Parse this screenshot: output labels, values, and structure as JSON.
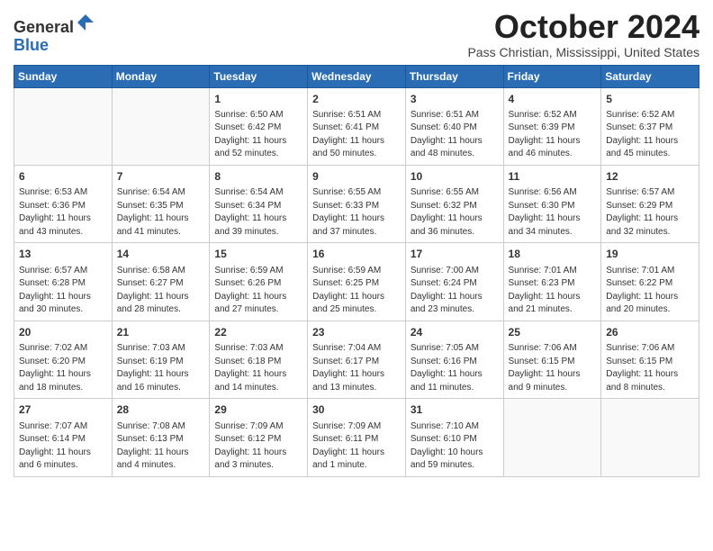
{
  "header": {
    "logo_general": "General",
    "logo_blue": "Blue",
    "month_title": "October 2024",
    "location": "Pass Christian, Mississippi, United States"
  },
  "days_of_week": [
    "Sunday",
    "Monday",
    "Tuesday",
    "Wednesday",
    "Thursday",
    "Friday",
    "Saturday"
  ],
  "weeks": [
    [
      {
        "day": "",
        "sunrise": "",
        "sunset": "",
        "daylight": "",
        "empty": true
      },
      {
        "day": "",
        "sunrise": "",
        "sunset": "",
        "daylight": "",
        "empty": true
      },
      {
        "day": "1",
        "sunrise": "Sunrise: 6:50 AM",
        "sunset": "Sunset: 6:42 PM",
        "daylight": "Daylight: 11 hours and 52 minutes.",
        "empty": false
      },
      {
        "day": "2",
        "sunrise": "Sunrise: 6:51 AM",
        "sunset": "Sunset: 6:41 PM",
        "daylight": "Daylight: 11 hours and 50 minutes.",
        "empty": false
      },
      {
        "day": "3",
        "sunrise": "Sunrise: 6:51 AM",
        "sunset": "Sunset: 6:40 PM",
        "daylight": "Daylight: 11 hours and 48 minutes.",
        "empty": false
      },
      {
        "day": "4",
        "sunrise": "Sunrise: 6:52 AM",
        "sunset": "Sunset: 6:39 PM",
        "daylight": "Daylight: 11 hours and 46 minutes.",
        "empty": false
      },
      {
        "day": "5",
        "sunrise": "Sunrise: 6:52 AM",
        "sunset": "Sunset: 6:37 PM",
        "daylight": "Daylight: 11 hours and 45 minutes.",
        "empty": false
      }
    ],
    [
      {
        "day": "6",
        "sunrise": "Sunrise: 6:53 AM",
        "sunset": "Sunset: 6:36 PM",
        "daylight": "Daylight: 11 hours and 43 minutes.",
        "empty": false
      },
      {
        "day": "7",
        "sunrise": "Sunrise: 6:54 AM",
        "sunset": "Sunset: 6:35 PM",
        "daylight": "Daylight: 11 hours and 41 minutes.",
        "empty": false
      },
      {
        "day": "8",
        "sunrise": "Sunrise: 6:54 AM",
        "sunset": "Sunset: 6:34 PM",
        "daylight": "Daylight: 11 hours and 39 minutes.",
        "empty": false
      },
      {
        "day": "9",
        "sunrise": "Sunrise: 6:55 AM",
        "sunset": "Sunset: 6:33 PM",
        "daylight": "Daylight: 11 hours and 37 minutes.",
        "empty": false
      },
      {
        "day": "10",
        "sunrise": "Sunrise: 6:55 AM",
        "sunset": "Sunset: 6:32 PM",
        "daylight": "Daylight: 11 hours and 36 minutes.",
        "empty": false
      },
      {
        "day": "11",
        "sunrise": "Sunrise: 6:56 AM",
        "sunset": "Sunset: 6:30 PM",
        "daylight": "Daylight: 11 hours and 34 minutes.",
        "empty": false
      },
      {
        "day": "12",
        "sunrise": "Sunrise: 6:57 AM",
        "sunset": "Sunset: 6:29 PM",
        "daylight": "Daylight: 11 hours and 32 minutes.",
        "empty": false
      }
    ],
    [
      {
        "day": "13",
        "sunrise": "Sunrise: 6:57 AM",
        "sunset": "Sunset: 6:28 PM",
        "daylight": "Daylight: 11 hours and 30 minutes.",
        "empty": false
      },
      {
        "day": "14",
        "sunrise": "Sunrise: 6:58 AM",
        "sunset": "Sunset: 6:27 PM",
        "daylight": "Daylight: 11 hours and 28 minutes.",
        "empty": false
      },
      {
        "day": "15",
        "sunrise": "Sunrise: 6:59 AM",
        "sunset": "Sunset: 6:26 PM",
        "daylight": "Daylight: 11 hours and 27 minutes.",
        "empty": false
      },
      {
        "day": "16",
        "sunrise": "Sunrise: 6:59 AM",
        "sunset": "Sunset: 6:25 PM",
        "daylight": "Daylight: 11 hours and 25 minutes.",
        "empty": false
      },
      {
        "day": "17",
        "sunrise": "Sunrise: 7:00 AM",
        "sunset": "Sunset: 6:24 PM",
        "daylight": "Daylight: 11 hours and 23 minutes.",
        "empty": false
      },
      {
        "day": "18",
        "sunrise": "Sunrise: 7:01 AM",
        "sunset": "Sunset: 6:23 PM",
        "daylight": "Daylight: 11 hours and 21 minutes.",
        "empty": false
      },
      {
        "day": "19",
        "sunrise": "Sunrise: 7:01 AM",
        "sunset": "Sunset: 6:22 PM",
        "daylight": "Daylight: 11 hours and 20 minutes.",
        "empty": false
      }
    ],
    [
      {
        "day": "20",
        "sunrise": "Sunrise: 7:02 AM",
        "sunset": "Sunset: 6:20 PM",
        "daylight": "Daylight: 11 hours and 18 minutes.",
        "empty": false
      },
      {
        "day": "21",
        "sunrise": "Sunrise: 7:03 AM",
        "sunset": "Sunset: 6:19 PM",
        "daylight": "Daylight: 11 hours and 16 minutes.",
        "empty": false
      },
      {
        "day": "22",
        "sunrise": "Sunrise: 7:03 AM",
        "sunset": "Sunset: 6:18 PM",
        "daylight": "Daylight: 11 hours and 14 minutes.",
        "empty": false
      },
      {
        "day": "23",
        "sunrise": "Sunrise: 7:04 AM",
        "sunset": "Sunset: 6:17 PM",
        "daylight": "Daylight: 11 hours and 13 minutes.",
        "empty": false
      },
      {
        "day": "24",
        "sunrise": "Sunrise: 7:05 AM",
        "sunset": "Sunset: 6:16 PM",
        "daylight": "Daylight: 11 hours and 11 minutes.",
        "empty": false
      },
      {
        "day": "25",
        "sunrise": "Sunrise: 7:06 AM",
        "sunset": "Sunset: 6:15 PM",
        "daylight": "Daylight: 11 hours and 9 minutes.",
        "empty": false
      },
      {
        "day": "26",
        "sunrise": "Sunrise: 7:06 AM",
        "sunset": "Sunset: 6:15 PM",
        "daylight": "Daylight: 11 hours and 8 minutes.",
        "empty": false
      }
    ],
    [
      {
        "day": "27",
        "sunrise": "Sunrise: 7:07 AM",
        "sunset": "Sunset: 6:14 PM",
        "daylight": "Daylight: 11 hours and 6 minutes.",
        "empty": false
      },
      {
        "day": "28",
        "sunrise": "Sunrise: 7:08 AM",
        "sunset": "Sunset: 6:13 PM",
        "daylight": "Daylight: 11 hours and 4 minutes.",
        "empty": false
      },
      {
        "day": "29",
        "sunrise": "Sunrise: 7:09 AM",
        "sunset": "Sunset: 6:12 PM",
        "daylight": "Daylight: 11 hours and 3 minutes.",
        "empty": false
      },
      {
        "day": "30",
        "sunrise": "Sunrise: 7:09 AM",
        "sunset": "Sunset: 6:11 PM",
        "daylight": "Daylight: 11 hours and 1 minute.",
        "empty": false
      },
      {
        "day": "31",
        "sunrise": "Sunrise: 7:10 AM",
        "sunset": "Sunset: 6:10 PM",
        "daylight": "Daylight: 10 hours and 59 minutes.",
        "empty": false
      },
      {
        "day": "",
        "sunrise": "",
        "sunset": "",
        "daylight": "",
        "empty": true
      },
      {
        "day": "",
        "sunrise": "",
        "sunset": "",
        "daylight": "",
        "empty": true
      }
    ]
  ]
}
